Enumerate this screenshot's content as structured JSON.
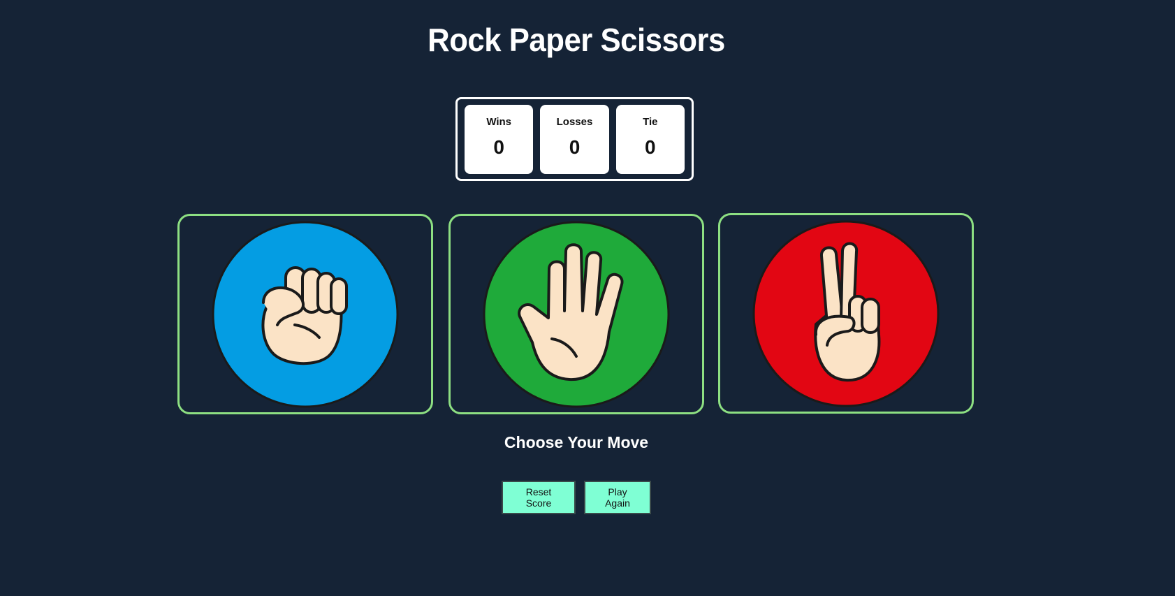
{
  "header": {
    "title": "Rock Paper Scissors"
  },
  "scoreboard": {
    "wins_label": "Wins",
    "wins_value": "0",
    "losses_label": "Losses",
    "losses_value": "0",
    "tie_label": "Tie",
    "tie_value": "0"
  },
  "moves": [
    {
      "name": "rock",
      "icon": "fist-icon",
      "color": "#049de3"
    },
    {
      "name": "paper",
      "icon": "open-hand-icon",
      "color": "#1faa3a"
    },
    {
      "name": "scissors",
      "icon": "peace-hand-icon",
      "color": "#e20613"
    }
  ],
  "prompt": "Choose Your Move",
  "actions": {
    "reset_label": "Reset Score",
    "play_again_label": "Play Again"
  },
  "colors": {
    "background": "#152336",
    "card_border": "#8ddf82",
    "button_bg": "#7fffd4",
    "skin": "#fbe3c6"
  }
}
